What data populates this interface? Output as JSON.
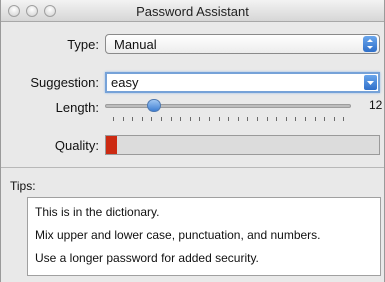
{
  "window": {
    "title": "Password Assistant"
  },
  "type_row": {
    "label": "Type:",
    "value": "Manual"
  },
  "suggestion_row": {
    "label": "Suggestion:",
    "value": "easy"
  },
  "length_row": {
    "label": "Length:",
    "value": 12,
    "max_label": "12",
    "fill_fraction": 0.2
  },
  "quality_row": {
    "label": "Quality:",
    "strength_fraction": 0.04,
    "fill_color": "#cc2a12"
  },
  "tips": {
    "label": "Tips:",
    "lines": [
      "This is in the dictionary.",
      "Mix upper and lower case, punctuation, and numbers.",
      "Use a longer password for added security."
    ]
  },
  "icons": [
    "close-button",
    "minimize-button",
    "zoom-button",
    "popup-arrows-icon",
    "suggestion-dropdown-icon",
    "slider-thumb"
  ]
}
